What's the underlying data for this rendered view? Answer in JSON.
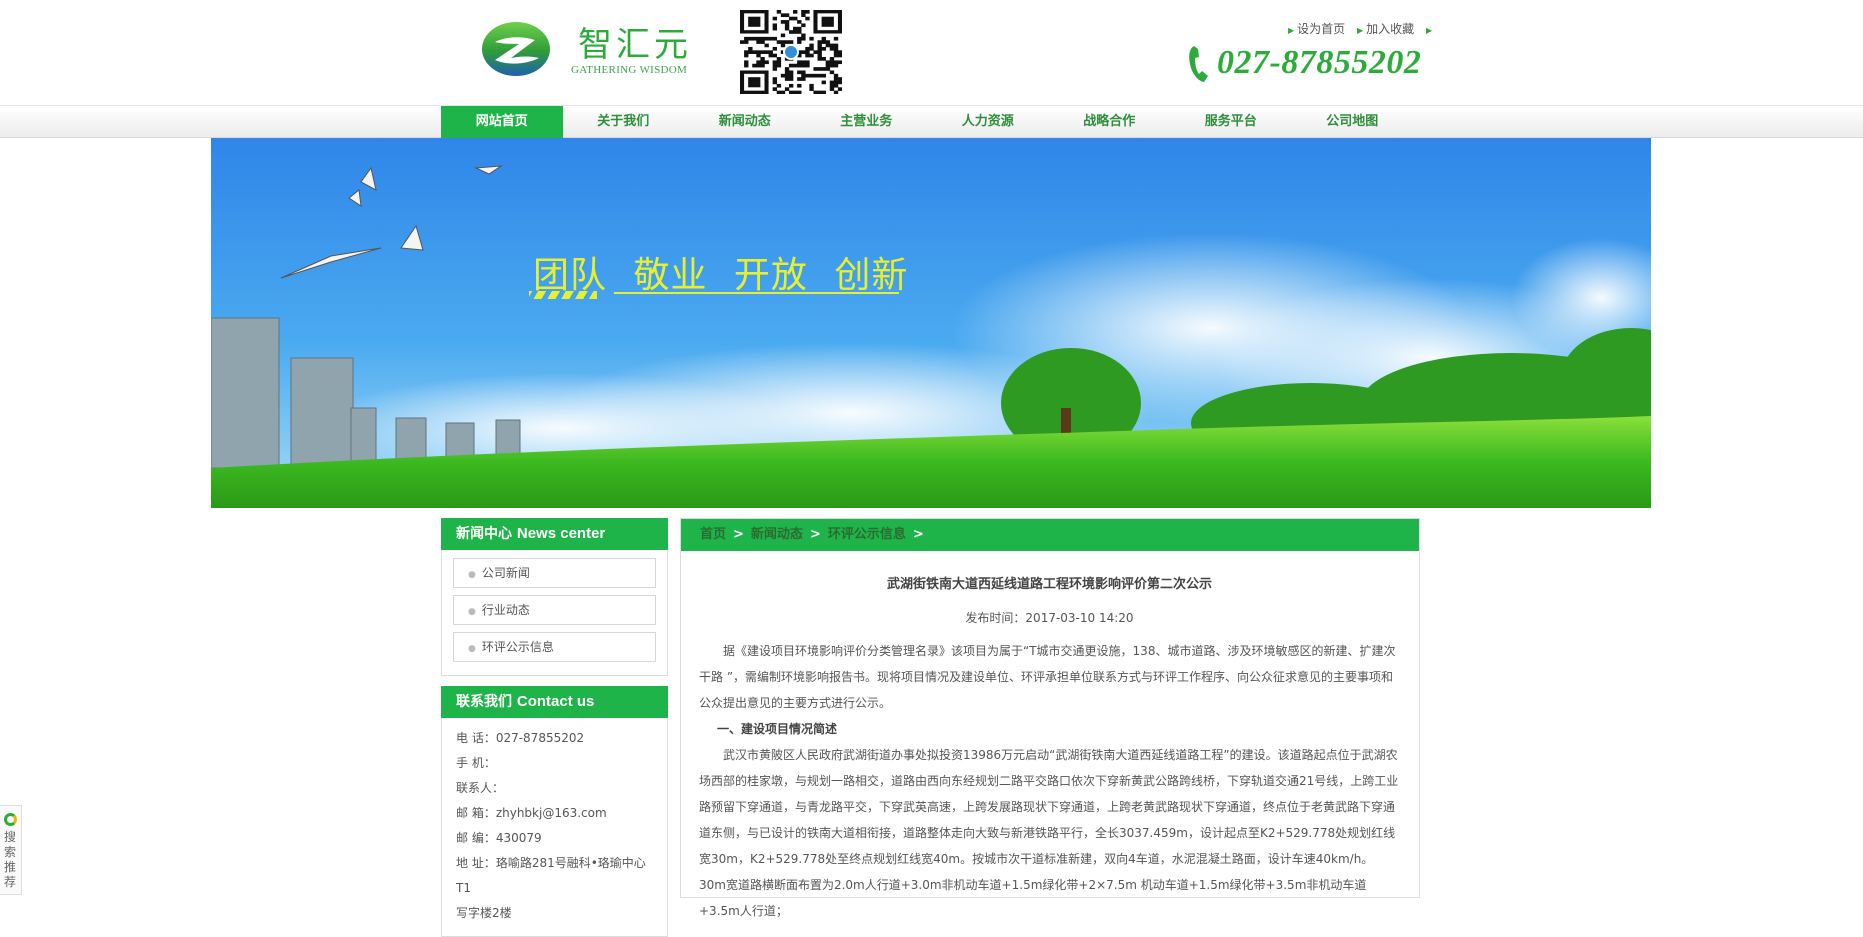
{
  "header": {
    "logo_cn": "智汇元",
    "logo_en": "GATHERING WISDOM",
    "toplinks": [
      "设为首页",
      "加入收藏"
    ],
    "phone": "027-87855202",
    "brand_color": "#2cab3a"
  },
  "nav": {
    "items": [
      {
        "label": "网站首页",
        "active": true
      },
      {
        "label": "关于我们"
      },
      {
        "label": "新闻动态"
      },
      {
        "label": "主营业务"
      },
      {
        "label": "人力资源"
      },
      {
        "label": "战略合作"
      },
      {
        "label": "服务平台"
      },
      {
        "label": "公司地图"
      }
    ]
  },
  "banner": {
    "slogan": "团队 敬业 开放 创新"
  },
  "news_center": {
    "title_cn": "新闻中心",
    "title_en": "News center",
    "items": [
      "公司新闻",
      "行业动态",
      "环评公示信息"
    ]
  },
  "contact": {
    "title_cn": "联系我们",
    "title_en": "Contact us",
    "lines": [
      "电 话：027-87855202",
      "手 机：",
      "联系人：",
      "邮 箱：zhyhbkj@163.com",
      "邮 编：430079",
      "地 址：珞喻路281号融科•珞瑜中心T1",
      "写字楼2楼"
    ]
  },
  "breadcrumb": [
    "首页",
    "新闻动态",
    "环评公示信息"
  ],
  "breadcrumb_sep": ">",
  "article": {
    "title": "武湖街铁南大道西延线道路工程环境影响评价第二次公示",
    "date": "发布时间：2017-03-10 14:20",
    "para1": "据《建设项目环境影响评价分类管理名录》该项目为属于“T城市交通更设施，138、城市道路、涉及环境敏感区的新建、扩建次干路 ”，需编制环境影响报告书。现将项目情况及建设单位、环评承担单位联系方式与环评工作程序、向公众征求意见的主要事项和公众提出意见的主要方式进行公示。",
    "subhead": "一、建设项目情况简述",
    "para2": "武汉市黄陂区人民政府武湖街道办事处拟投资13986万元启动“武湖街铁南大道西延线道路工程”的建设。该道路起点位于武湖农场西部的桂家墩，与规划一路相交，道路由西向东经规划二路平交路口依次下穿新黄武公路跨线桥，下穿轨道交通21号线，上跨工业路预留下穿通道，与青龙路平交，下穿武英高速，上跨发展路现状下穿通道，上跨老黄武路现状下穿通道，终点位于老黄武路下穿通道东侧，与已设计的铁南大道相衔接，道路整体走向大致与新港铁路平行，全长3037.459m，设计起点至K2+529.778处规划红线宽30m，K2+529.778处至终点规划红线宽40m。按城市次干道标准新建，双向4车道，水泥混凝土路面，设计车速40km/h。30m宽道路横断面布置为2.0m人行道+3.0m非机动车道+1.5m绿化带+2×7.5m 机动车道+1.5m绿化带+3.5m非机动车道+3.5m人行道；"
  },
  "side_widget": {
    "label": "搜索推荐"
  }
}
